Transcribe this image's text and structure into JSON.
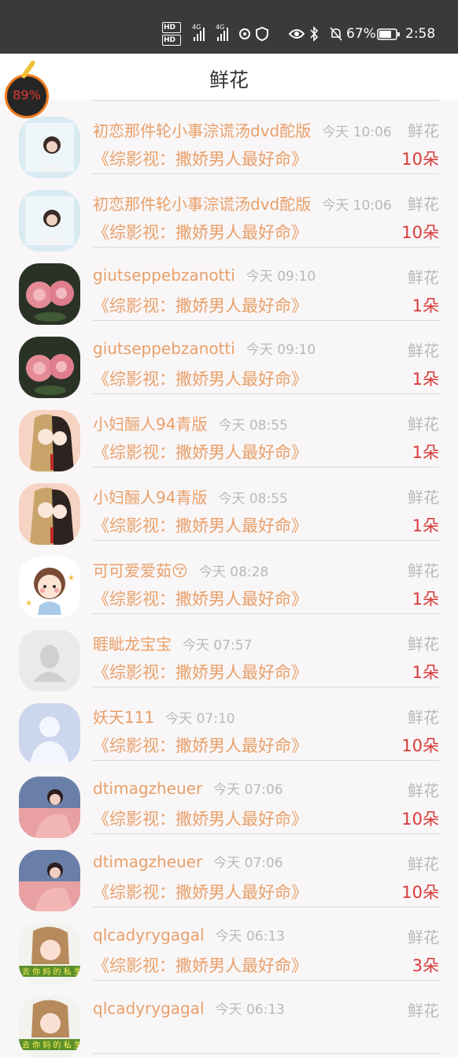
{
  "status_bar": {
    "network": "4G",
    "battery": "67%",
    "time": "2:58"
  },
  "header": {
    "title": "鲜花"
  },
  "float_badge": {
    "percent": "89%"
  },
  "rows": [
    {
      "name": "初恋那件轮小事淙谎汤dvd酡版",
      "time": "今天 10:06",
      "gift": "鲜花",
      "show": "《综影视：撒娇男人最好命》",
      "count": "10朵",
      "avatar": "avatar-woman"
    },
    {
      "name": "初恋那件轮小事淙谎汤dvd酡版",
      "time": "今天 10:06",
      "gift": "鲜花",
      "show": "《综影视：撒娇男人最好命》",
      "count": "10朵",
      "avatar": "avatar-woman"
    },
    {
      "name": "giutseppebzanotti",
      "time": "今天 09:10",
      "gift": "鲜花",
      "show": "《综影视：撒娇男人最好命》",
      "count": "1朵",
      "avatar": "avatar-roses"
    },
    {
      "name": "giutseppebzanotti",
      "time": "今天 09:10",
      "gift": "鲜花",
      "show": "《综影视：撒娇男人最好命》",
      "count": "1朵",
      "avatar": "avatar-roses"
    },
    {
      "name": "小妇酾人94青版",
      "time": "今天 08:55",
      "gift": "鲜花",
      "show": "《综影视：撒娇男人最好命》",
      "count": "1朵",
      "avatar": "avatar-anime"
    },
    {
      "name": "小妇酾人94青版",
      "time": "今天 08:55",
      "gift": "鲜花",
      "show": "《综影视：撒娇男人最好命》",
      "count": "1朵",
      "avatar": "avatar-anime"
    },
    {
      "name": "可可爱爱茹😚",
      "time": "今天 08:28",
      "gift": "鲜花",
      "show": "《综影视：撒娇男人最好命》",
      "count": "1朵",
      "avatar": "avatar-cartoon"
    },
    {
      "name": "睚眦龙宝宝",
      "time": "今天 07:57",
      "gift": "鲜花",
      "show": "《综影视：撒娇男人最好命》",
      "count": "1朵",
      "avatar": "avatar-default-gray"
    },
    {
      "name": "妖天111",
      "time": "今天 07:10",
      "gift": "鲜花",
      "show": "《综影视：撒娇男人最好命》",
      "count": "10朵",
      "avatar": "avatar-default-blue"
    },
    {
      "name": "dtimagzheuer",
      "time": "今天 07:06",
      "gift": "鲜花",
      "show": "《综影视：撒娇男人最好命》",
      "count": "10朵",
      "avatar": "avatar-couple"
    },
    {
      "name": "dtimagzheuer",
      "time": "今天 07:06",
      "gift": "鲜花",
      "show": "《综影视：撒娇男人最好命》",
      "count": "10朵",
      "avatar": "avatar-couple"
    },
    {
      "name": "qlcadyrygagal",
      "time": "今天 06:13",
      "gift": "鲜花",
      "show": "《综影视：撒娇男人最好命》",
      "count": "3朵",
      "avatar": "avatar-girl"
    },
    {
      "name": "qlcadyrygagal",
      "time": "今天 06:13",
      "gift": "鲜花",
      "show": "",
      "count": "",
      "avatar": "avatar-girl"
    }
  ]
}
